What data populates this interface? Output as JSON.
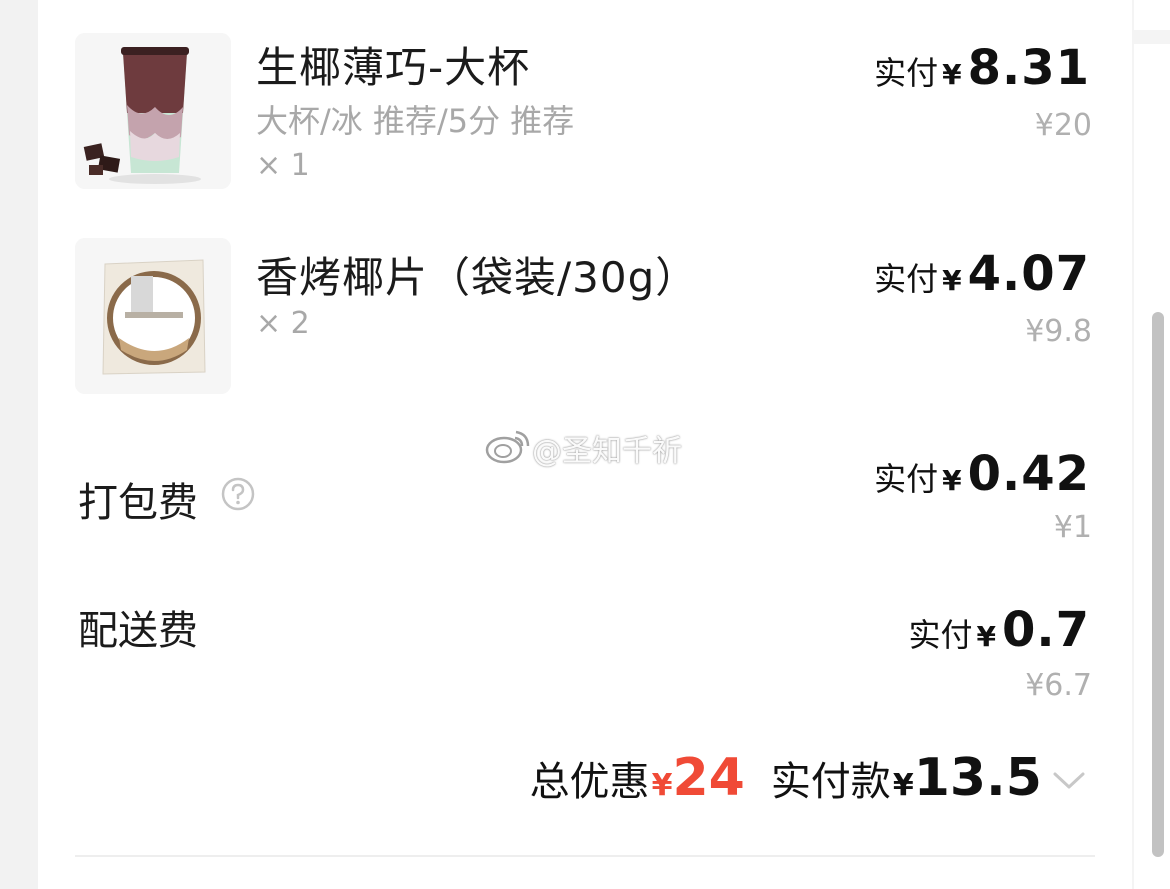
{
  "items": [
    {
      "name": "生椰薄巧-大杯",
      "spec": "大杯/冰 推荐/5分 推荐",
      "qty": "× 1",
      "paid_label": "实付",
      "paid_currency": "¥",
      "paid_amount": "8.31",
      "original_price": "¥20"
    },
    {
      "name": "香烤椰片（袋装/30g）",
      "spec": "",
      "qty": "× 2",
      "paid_label": "实付",
      "paid_currency": "¥",
      "paid_amount": "4.07",
      "original_price": "¥9.8"
    }
  ],
  "fees": {
    "packing": {
      "label": "打包费",
      "paid_label": "实付",
      "paid_currency": "¥",
      "paid_amount": "0.42",
      "original_price": "¥1"
    },
    "delivery": {
      "label": "配送费",
      "paid_label": "实付",
      "paid_currency": "¥",
      "paid_amount": "0.7",
      "original_price": "¥6.7"
    }
  },
  "watermark": "@圣知千祈",
  "summary": {
    "discount_label": "总优惠",
    "discount_currency": "¥",
    "discount_amount": "24",
    "total_label": "实付款",
    "total_currency": "¥",
    "total_amount": "13.5"
  },
  "colors": {
    "accent_red": "#f04a36",
    "muted_text": "#a8a8a8",
    "background": "#ffffff"
  },
  "icons": {
    "packing_help": "question-circle-icon",
    "expand": "chevron-down-icon",
    "watermark_logo": "weibo-logo-icon"
  }
}
